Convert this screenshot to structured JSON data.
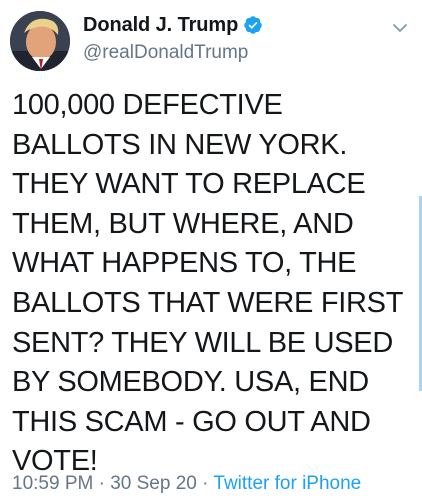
{
  "author": {
    "display_name": "Donald J. Trump",
    "handle": "@realDonaldTrump",
    "verified": true
  },
  "icons": {
    "avatar": "profile-avatar",
    "verified": "verified-badge-icon",
    "menu": "chevron-down-icon"
  },
  "tweet": {
    "text": "100,000 DEFECTIVE\nBALLOTS IN NEW YORK.\nTHEY WANT TO REPLACE\nTHEM, BUT WHERE, AND\nWHAT HAPPENS TO, THE\nBALLOTS THAT WERE FIRST\nSENT? THEY WILL BE USED\nBY SOMEBODY. USA, END\nTHIS SCAM - GO OUT AND\nVOTE!"
  },
  "meta": {
    "time": "10:59 PM",
    "separator": " · ",
    "date": "30 Sep 20",
    "source": "Twitter for iPhone"
  },
  "colors": {
    "text": "#14171a",
    "secondary": "#657786",
    "accent": "#1da1f2"
  }
}
